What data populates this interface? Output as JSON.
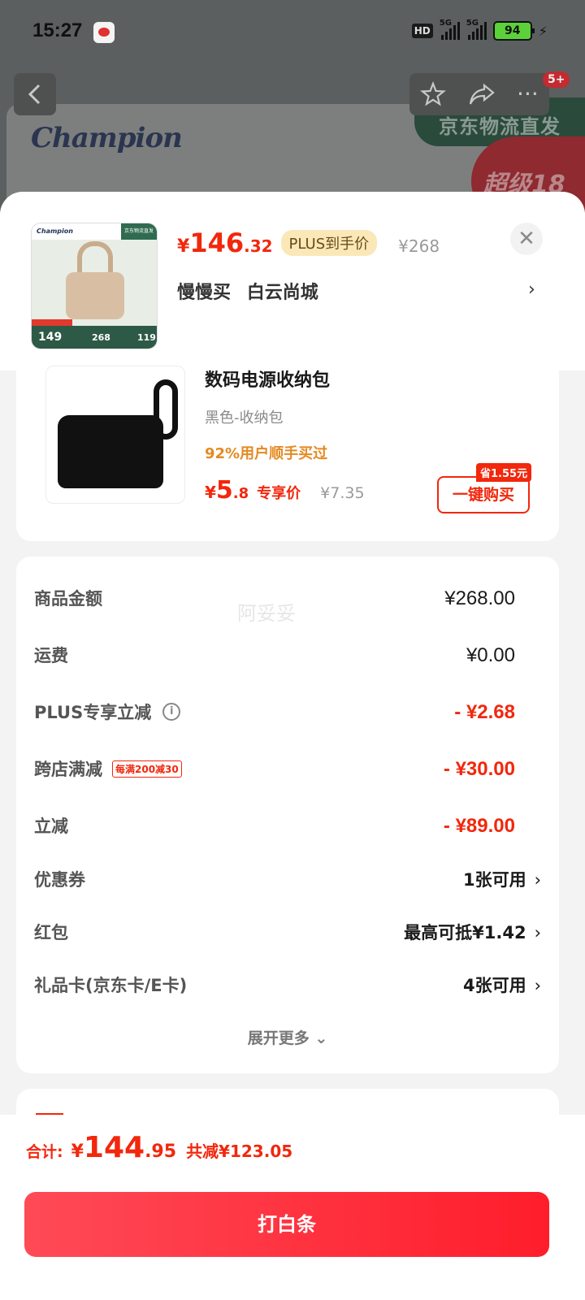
{
  "status_bar": {
    "time": "15:27",
    "network_badge": "HD",
    "signal_1": "5G",
    "signal_2": "5G",
    "battery": "94"
  },
  "background": {
    "brand": "Champion",
    "logistics_banner": "京东物流直发",
    "promo_banner": "超级18",
    "notification_badge": "5+"
  },
  "product": {
    "price_symbol": "¥",
    "price_int": "146",
    "price_dec": ".32",
    "plus_tag": "PLUS到手价",
    "original_price": "¥268",
    "options": [
      "慢慢买",
      "白云尚城"
    ],
    "thumb_brand": "Champion",
    "thumb_jd": "京东物流直发",
    "thumb_price_1": "149",
    "thumb_price_2": "268",
    "thumb_price_3": "119"
  },
  "recommendation": {
    "title": "数码电源收纳包",
    "variant": "黑色-收纳包",
    "stat": "92%用户顺手买过",
    "price_symbol": "¥",
    "price_int": "5",
    "price_dec": ".8",
    "exclusive_label": "专享价",
    "original_price": "¥7.35",
    "save_badge": "省1.55元",
    "buy_button": "一键购买"
  },
  "amounts": {
    "watermark": "阿妥妥",
    "rows": [
      {
        "label": "商品金额",
        "value": "¥268.00"
      },
      {
        "label": "运费",
        "value": "¥0.00"
      },
      {
        "label": "PLUS专享立减",
        "value": "- ¥2.68"
      },
      {
        "label": "跨店满减",
        "tag": "每满200减30",
        "value": "- ¥30.00"
      },
      {
        "label": "立减",
        "value": "- ¥89.00"
      },
      {
        "label": "优惠券",
        "value": "1张可用"
      },
      {
        "label": "红包",
        "value": "最高可抵¥1.42"
      },
      {
        "label": "礼品卡(京东卡/E卡)",
        "value": "4张可用"
      }
    ],
    "expand_label": "展开更多",
    "chevron": "›",
    "expand_chevron": "⌄"
  },
  "footer": {
    "total_label": "合计:",
    "total_symbol": "¥",
    "total_int": "144",
    "total_dec": ".95",
    "total_saved": "共减¥123.05",
    "pay_button": "打白条"
  },
  "colors": {
    "accent_red": "#f2270c",
    "plus_gold": "#fbe8b8",
    "orange_stat": "#e48a22"
  },
  "icons": {
    "back": "back-arrow-icon",
    "favorite": "star-icon",
    "share": "share-icon",
    "more": "more-icon",
    "close": "close-icon",
    "info": "info-icon"
  }
}
